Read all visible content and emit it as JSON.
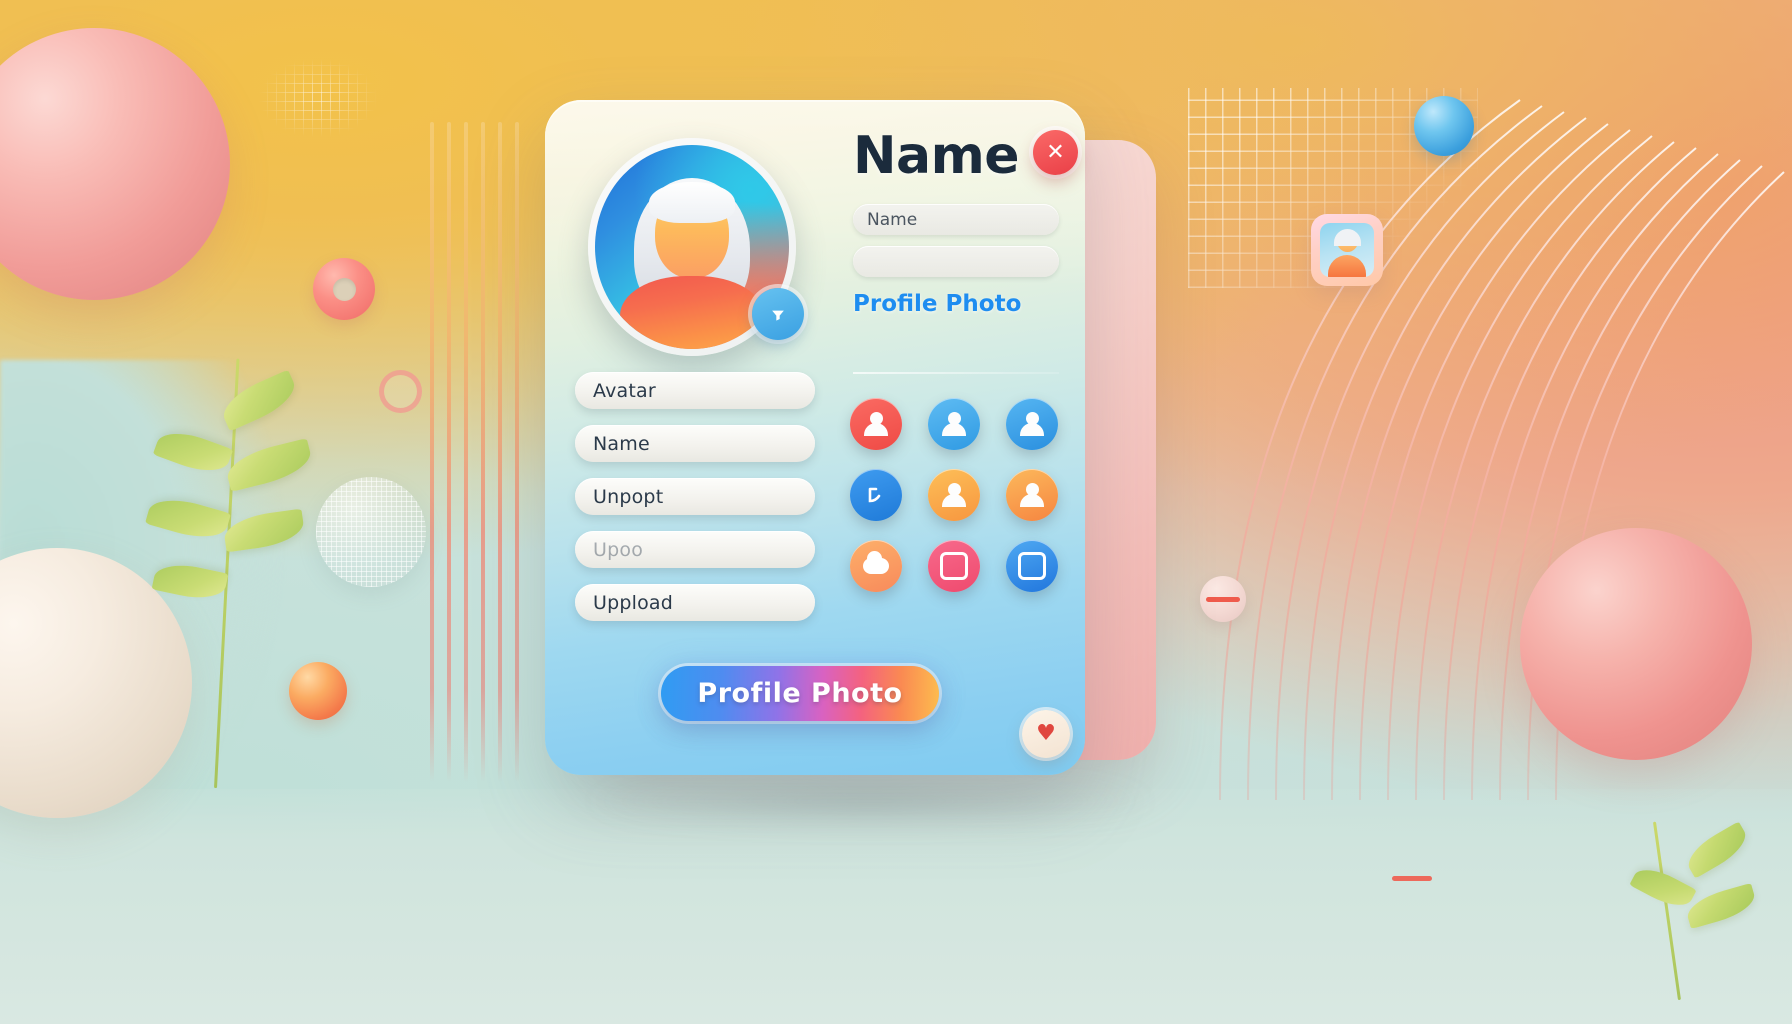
{
  "card": {
    "title": "Name",
    "name_input_value": "Name",
    "secondary_input_value": "",
    "secondary_input_placeholder": "",
    "profile_photo_link": "Profile Photo",
    "cta_label": "Profile Photo",
    "close_label": "✕",
    "heart_label": "♥",
    "avatar_badge_icon": "verified-badge-icon"
  },
  "fields": [
    {
      "label": "Avatar",
      "faded": false
    },
    {
      "label": "Name",
      "faded": false
    },
    {
      "label": "Unpopt",
      "faded": false
    },
    {
      "label": "Upoo",
      "faded": true
    },
    {
      "label": "Uppload",
      "faded": false
    }
  ],
  "icon_grid": [
    {
      "name": "user-avatar-icon",
      "color": "#f5564e",
      "glyph": "person"
    },
    {
      "name": "user-profile-icon",
      "color": "#3f9fe4",
      "glyph": "person"
    },
    {
      "name": "user-contact-icon",
      "color": "#3b96e2",
      "glyph": "person"
    },
    {
      "name": "edit-profile-icon",
      "color": "#2f8fe0",
      "glyph": "edit"
    },
    {
      "name": "user-orange-icon",
      "color": "#f89a42",
      "glyph": "person"
    },
    {
      "name": "user-orange-alt-icon",
      "color": "#f78c45",
      "glyph": "person"
    },
    {
      "name": "upload-cloud-icon",
      "color": "#fa9a5e",
      "glyph": "cloud"
    },
    {
      "name": "camera-icon",
      "color": "#f1536f",
      "glyph": "camera"
    },
    {
      "name": "photo-frame-icon",
      "color": "#2a86e0",
      "glyph": "frame"
    }
  ],
  "decor": {
    "mini_chip_label": "mini-avatar-chip"
  },
  "colors": {
    "accent_blue": "#1e8df0",
    "danger_red": "#ea3f47",
    "title_ink": "#1b2b3c",
    "card_top": "#fbf5dd",
    "card_bottom": "#7fcbf1"
  }
}
